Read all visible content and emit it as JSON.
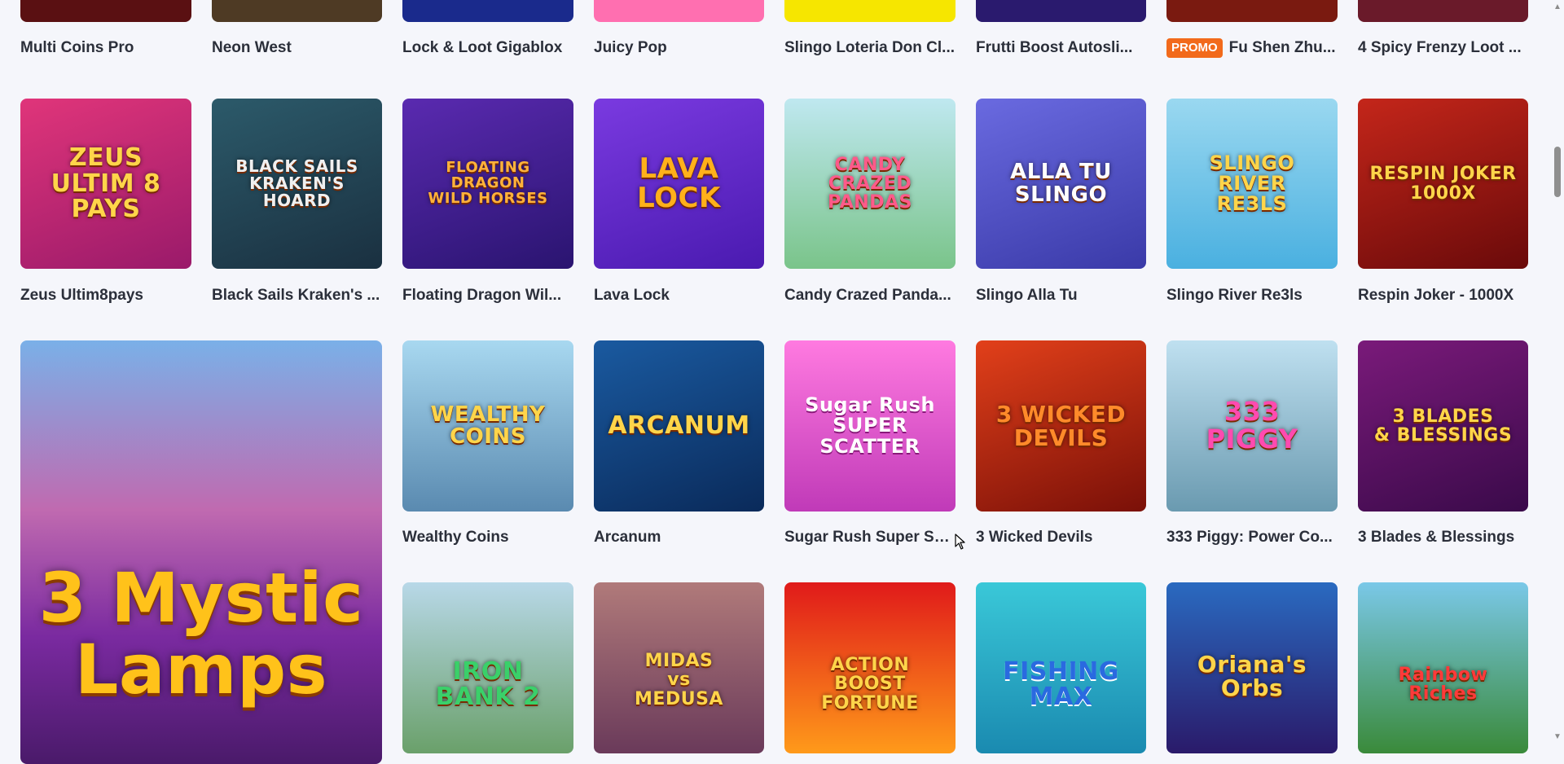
{
  "row0": [
    {
      "name": "Multi Coins Pro",
      "bg": "#5a1012",
      "badge": ""
    },
    {
      "name": "Neon West",
      "bg": "#4e3a24",
      "badge": ""
    },
    {
      "name": "Lock & Loot Gigablox",
      "bg": "#1a2a8c",
      "badge": ""
    },
    {
      "name": "Juicy Pop",
      "bg": "#ff6fb0",
      "badge": ""
    },
    {
      "name": "Slingo Loteria Don Cl...",
      "bg": "#f6e600",
      "badge": ""
    },
    {
      "name": "Frutti Boost Autosli...",
      "bg": "#2a1a6e",
      "badge": ""
    },
    {
      "name": "Fu Shen Zhu...",
      "bg": "#7a1a10",
      "badge": "PROMO"
    },
    {
      "name": "4 Spicy Frenzy Loot ...",
      "bg": "#6a1a2a",
      "badge": ""
    }
  ],
  "row1": [
    {
      "name": "Zeus Ultim8pays",
      "art": "ZEUS\nULTIM 8 PAYS",
      "bg": "linear-gradient(160deg,#e0357a,#9a1a6a)"
    },
    {
      "name": "Black Sails Kraken's ...",
      "art": "BLACK SAILS\nKRAKEN'S HOARD",
      "bg": "linear-gradient(160deg,#2c5a6a,#1a3040)"
    },
    {
      "name": "Floating Dragon Wil...",
      "art": "FLOATING DRAGON\nWILD HORSES",
      "bg": "linear-gradient(160deg,#5a2ab0,#2a1470)"
    },
    {
      "name": "Lava Lock",
      "art": "LAVA\nLOCK",
      "bg": "linear-gradient(160deg,#7a3ae0,#4a1ab0)"
    },
    {
      "name": "Candy Crazed Panda...",
      "art": "CANDY\nCRAZED\nPANDAS",
      "bg": "linear-gradient(180deg,#bfe8f0,#7ac48a)"
    },
    {
      "name": "Slingo Alla Tu",
      "art": "ALLA TU\nSLINGO",
      "bg": "linear-gradient(160deg,#6a6ae0,#3a3aa8)"
    },
    {
      "name": "Slingo River Re3ls",
      "art": "SLINGO\nRIVER\nRE3LS",
      "bg": "linear-gradient(180deg,#9ad8f0,#4ab0e0)"
    },
    {
      "name": "Respin Joker - 1000X",
      "art": "RESPIN JOKER\n1000X",
      "bg": "linear-gradient(160deg,#c4261a,#6a0a0a)"
    }
  ],
  "row2": [
    {
      "name": "Wealthy Coins",
      "art": "WEALTHY\nCOINS",
      "bg": "linear-gradient(180deg,#a8d8f0,#5a8ab0)"
    },
    {
      "name": "Arcanum",
      "art": "ARCANUM",
      "bg": "linear-gradient(160deg,#1a5aa0,#0a2a5a)"
    },
    {
      "name": "Sugar Rush Super Sc...",
      "art": "Sugar Rush\nSUPER\nSCATTER",
      "bg": "linear-gradient(180deg,#ff7ae0,#c03ab8)"
    },
    {
      "name": "3 Wicked Devils",
      "art": "3 WICKED\nDEVILS",
      "bg": "linear-gradient(160deg,#e2401a,#7a1008)"
    },
    {
      "name": "333 Piggy: Power Co...",
      "art": "333\nPIGGY",
      "bg": "linear-gradient(180deg,#bfe0f0,#6a9ab0)"
    },
    {
      "name": "3 Blades & Blessings",
      "art": "3 BLADES\n& BLESSINGS",
      "bg": "linear-gradient(160deg,#7a1a7a,#3a0a4a)"
    }
  ],
  "featured": {
    "name": "3 Mystic Lamps",
    "art": "3 Mystic\nLamps"
  },
  "row3": [
    {
      "art": "IRON\nBANK 2",
      "bg": "linear-gradient(180deg,#b8d8e8,#6aa06a)"
    },
    {
      "art": "MIDAS\nvs\nMEDUSA",
      "bg": "linear-gradient(180deg,#b07a7a,#6a3a5a)"
    },
    {
      "art": "ACTION BOOST\nFORTUNE",
      "bg": "linear-gradient(180deg,#e01a1a,#ff9a1a)"
    },
    {
      "art": "FISHING\nMAX",
      "bg": "linear-gradient(180deg,#3ac8d8,#1a8ab0)"
    },
    {
      "art": "Oriana's\nOrbs",
      "bg": "linear-gradient(180deg,#2a6ac0,#2a1a6a)"
    },
    {
      "art": "Rainbow\nRiches",
      "bg": "linear-gradient(180deg,#7ac8e8,#3a8a3a)"
    }
  ]
}
